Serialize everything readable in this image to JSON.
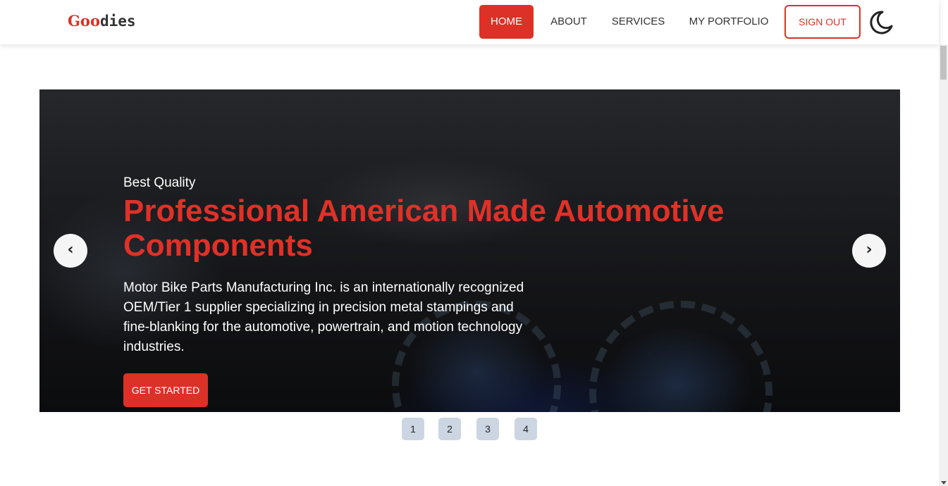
{
  "header": {
    "logo_accent": "Goo",
    "logo_rest": "dies",
    "nav": [
      {
        "label": "HOME",
        "active": true
      },
      {
        "label": "ABOUT",
        "active": false
      },
      {
        "label": "SERVICES",
        "active": false
      },
      {
        "label": "MY PORTFOLIO",
        "active": false
      }
    ],
    "signout_label": "SIGN OUT",
    "theme_icon": "moon-icon"
  },
  "hero": {
    "kicker": "Best Quality",
    "headline": "Professional American Made Automotive Components",
    "description": "Motor Bike Parts Manufacturing Inc. is an internationally recognized OEM/Tier 1 supplier specializing in precision metal stampings and fine-blanking for the automotive, powertrain, and motion technology industries.",
    "cta_label": "GET STARTED",
    "prev_icon": "‹",
    "next_icon": "›"
  },
  "pagination": {
    "pages": [
      "1",
      "2",
      "3",
      "4"
    ]
  },
  "colors": {
    "accent": "#dc3127",
    "page_dot": "#cbd6e2"
  }
}
